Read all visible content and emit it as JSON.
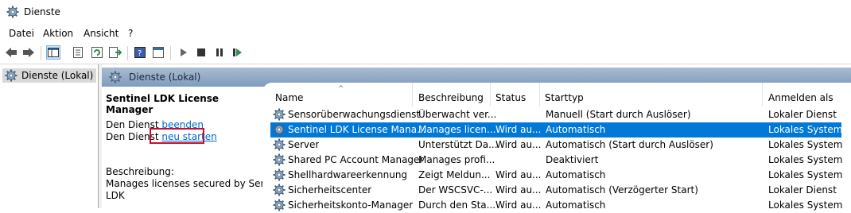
{
  "window": {
    "title": "Dienste"
  },
  "menu": [
    "Datei",
    "Aktion",
    "Ansicht",
    "?"
  ],
  "tree": {
    "item": "Dienste (Lokal)"
  },
  "pane": {
    "header": "Dienste (Lokal)"
  },
  "details": {
    "service_name": "Sentinel LDK License Manager",
    "prefix1": "Den Dienst",
    "stop_link": "beenden",
    "prefix2": "Den Dienst",
    "restart_link": "neu starten",
    "desc_label": "Beschreibung:",
    "desc_line1": "Manages licenses secured by Sentinel",
    "desc_line2": "LDK"
  },
  "columns": [
    "Name",
    "Beschreibung",
    "Status",
    "Starttyp",
    "Anmelden als"
  ],
  "rows": [
    [
      "Sensorüberwachungsdienst",
      "Überwacht ver...",
      "",
      "Manuell (Start durch Auslöser)",
      "Lokaler Dienst"
    ],
    [
      "Sentinel LDK License Mana...",
      "Manages licen...",
      "Wird au...",
      "Automatisch",
      "Lokales System"
    ],
    [
      "Server",
      "Unterstützt Da...",
      "Wird au...",
      "Automatisch (Start durch Auslöser)",
      "Lokales System"
    ],
    [
      "Shared PC Account Manager",
      "Manages profi...",
      "",
      "Deaktiviert",
      "Lokales System"
    ],
    [
      "Shellhardwareerkennung",
      "Zeigt Meldun...",
      "Wird au...",
      "Automatisch",
      "Lokales System"
    ],
    [
      "Sicherheitscenter",
      "Der WSCSVC-...",
      "Wird au...",
      "Automatisch (Verzögerter Start)",
      "Lokaler Dienst"
    ],
    [
      "Sicherheitskonto-Manager",
      "Durch den Sta...",
      "Wird au...",
      "Automatisch",
      "Lokales System"
    ]
  ],
  "colors": {
    "selection": "#0078d7",
    "link": "#0066cc",
    "highlight_box": "#c8102e",
    "header_gradient": "#7f9bbd"
  }
}
